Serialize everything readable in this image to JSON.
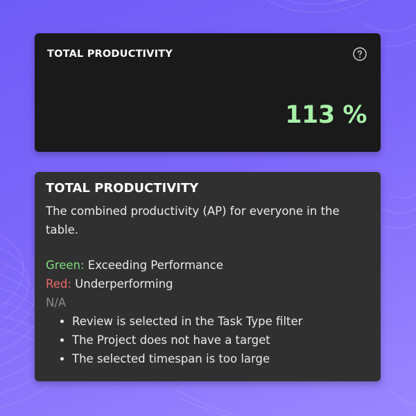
{
  "card": {
    "title": "TOTAL PRODUCTIVITY",
    "value": "113 %",
    "value_color": "#a8f0a8",
    "help_icon": "help-circle-icon"
  },
  "tooltip": {
    "title": "TOTAL PRODUCTIVITY",
    "description": "The combined productivity (AP) for everyone in the table.",
    "legend": {
      "green_label": "Green:",
      "green_text": "Exceeding Performance",
      "red_label": "Red:",
      "red_text": "Underperforming",
      "na_label": "N/A"
    },
    "reasons": [
      "Review is selected in the Task Type filter",
      "The Project does not have a target",
      "The selected timespan is too large"
    ]
  },
  "colors": {
    "background_accent": "#7e68fb",
    "card_bg": "#1a1a1a",
    "tooltip_bg": "#303030",
    "green": "#7ee07e",
    "red": "#ef6a6a",
    "na": "#8a8a8a"
  }
}
